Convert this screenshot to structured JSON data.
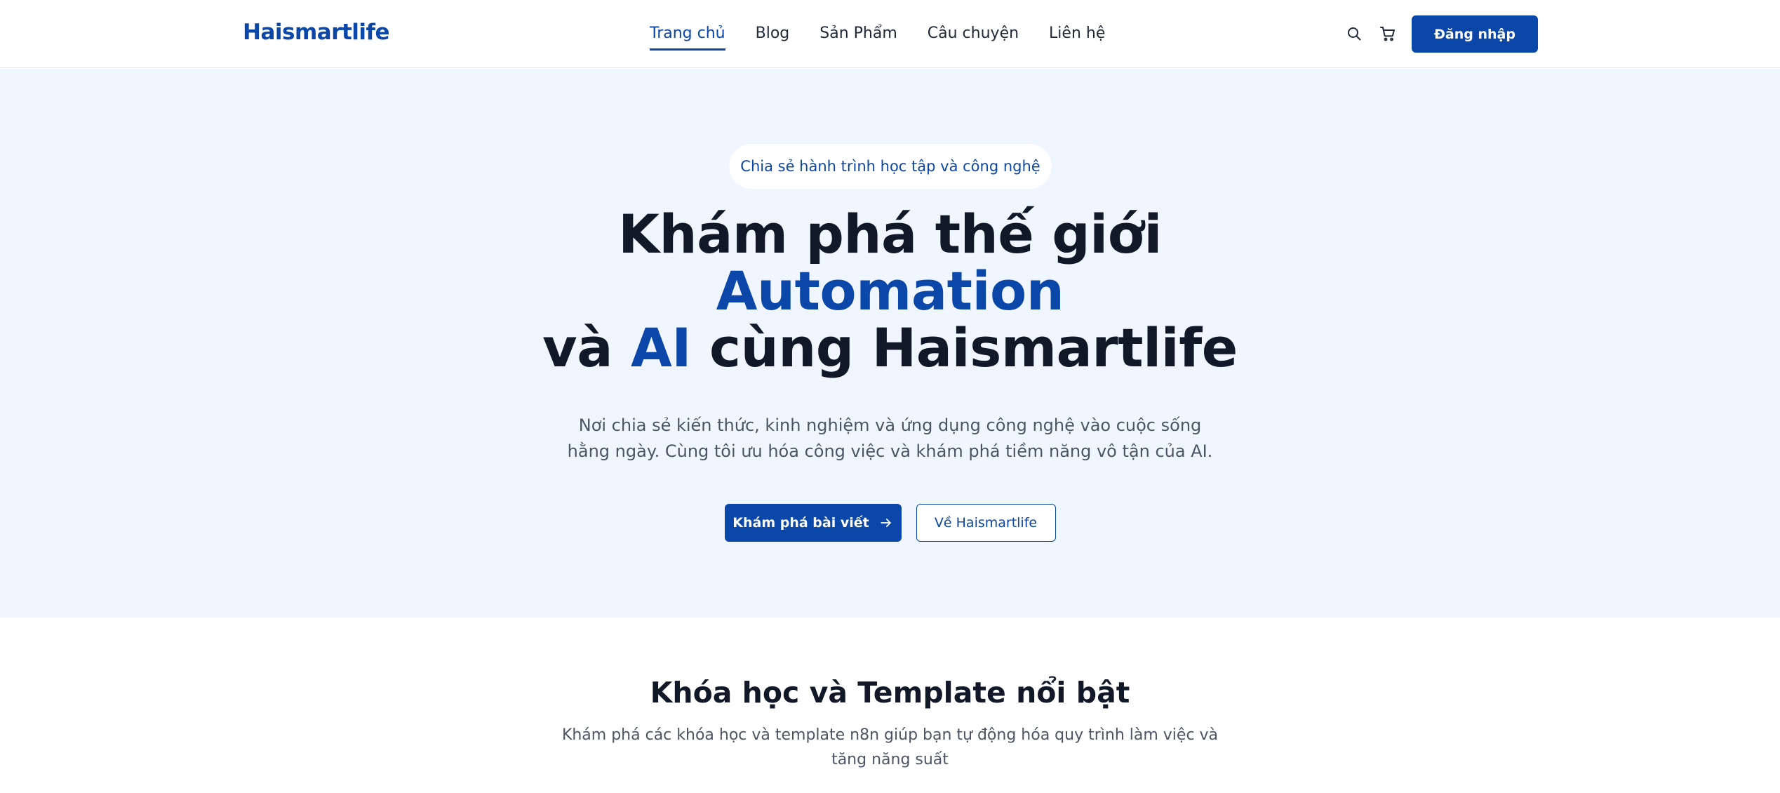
{
  "navbar": {
    "logo": "Haismartlife",
    "links": [
      {
        "label": "Trang chủ",
        "active": true
      },
      {
        "label": "Blog"
      },
      {
        "label": "Sản Phẩm"
      },
      {
        "label": "Câu chuyện"
      },
      {
        "label": "Liên hệ"
      }
    ],
    "icons": [
      "search-icon",
      "cart-icon"
    ],
    "login_label": "Đăng nhập"
  },
  "hero": {
    "badge": "Chia sẻ hành trình học tập và công nghệ",
    "title_line1": "Khám phá thế giới",
    "title_line2": "Automation",
    "title_line3_prefix": "và",
    "title_line3_highlight": "AI",
    "title_line3_suffix": "cùng Haismartlife",
    "subtitle": "Nơi chia sẻ kiến thức, kinh nghiệm và ứng dụng công nghệ vào cuộc sống hằng ngày. Cùng tôi ưu hóa công việc và khám phá tiềm năng vô tận của AI.",
    "primary_cta": "Khám phá bài viết",
    "secondary_cta": "Về Haismartlife"
  },
  "featured": {
    "title": "Khóa học và Template nổi bật",
    "subtitle": "Khám phá các khóa học và template n8n giúp bạn tự động hóa quy trình làm việc và tăng năng suất"
  },
  "colors": {
    "brand": "#0b47a8",
    "hero_bg": "#eff6ff",
    "text_dark": "#111827",
    "text_muted": "#4b5563"
  }
}
